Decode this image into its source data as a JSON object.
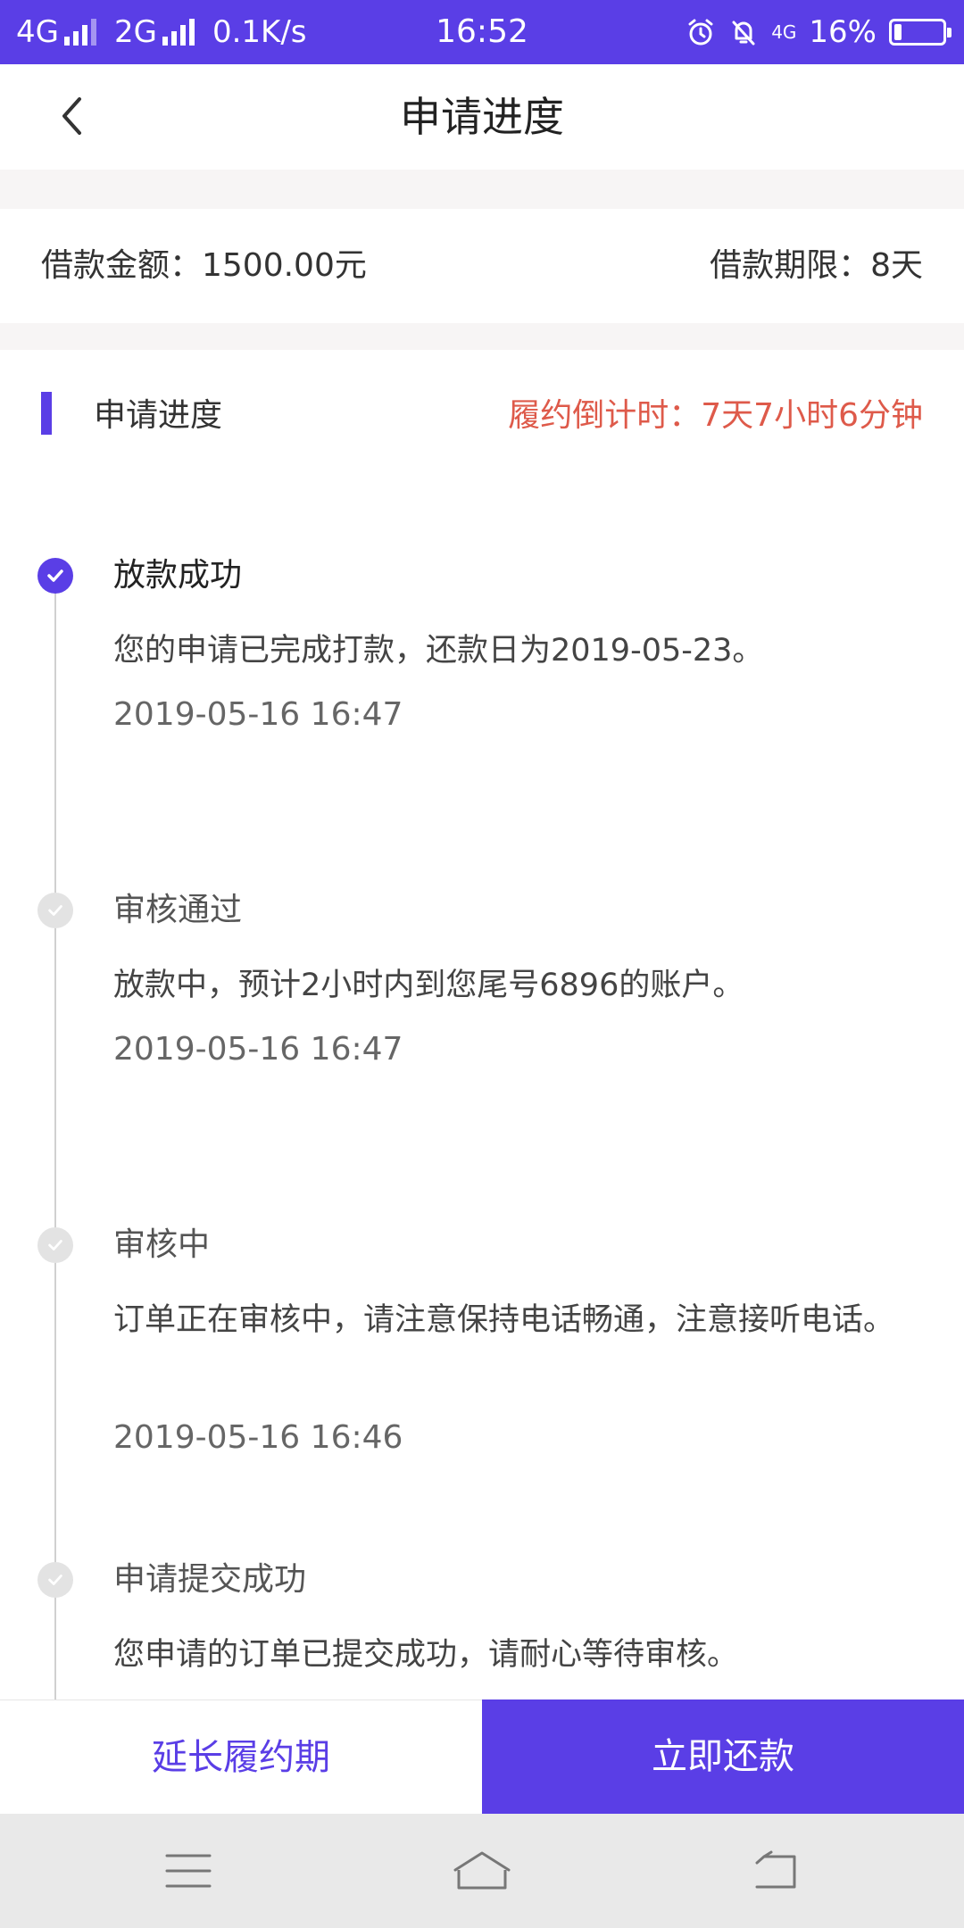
{
  "status_bar": {
    "network1": "4G",
    "network2": "2G",
    "speed": "0.1K/s",
    "time": "16:52",
    "small_network": "4G",
    "battery_text": "16%",
    "battery_level": 0.16,
    "icons": [
      "alarm-icon",
      "bell-off-icon",
      "4g-icon",
      "battery-icon"
    ]
  },
  "header": {
    "title": "申请进度",
    "back_icon": "chevron-left-icon"
  },
  "loan": {
    "amount": "借款金额：1500.00元",
    "term": "借款期限：8天"
  },
  "progress": {
    "section_title": "申请进度",
    "countdown": "履约倒计时：7天7小时6分钟",
    "steps": [
      {
        "title": "放款成功",
        "desc": "您的申请已完成打款，还款日为2019-05-23。",
        "time": "2019-05-16 16:47",
        "status": "active"
      },
      {
        "title": "审核通过",
        "desc": "放款中，预计2小时内到您尾号6896的账户。",
        "time": "2019-05-16 16:47",
        "status": "done"
      },
      {
        "title": "审核中",
        "desc": "订单正在审核中，请注意保持电话畅通，注意接听电话。",
        "time": "2019-05-16 16:46",
        "status": "done"
      },
      {
        "title": "申请提交成功",
        "desc": "您申请的订单已提交成功，请耐心等待审核。",
        "status": "done"
      }
    ]
  },
  "actions": {
    "extend_label": "延长履约期",
    "repay_label": "立即还款"
  },
  "system_nav": {
    "icons": [
      "menu-icon",
      "home-icon",
      "back-icon"
    ]
  },
  "colors": {
    "accent": "#5a3ee6",
    "countdown": "#de5a4a",
    "inactive_dot": "#e3e3e3"
  }
}
